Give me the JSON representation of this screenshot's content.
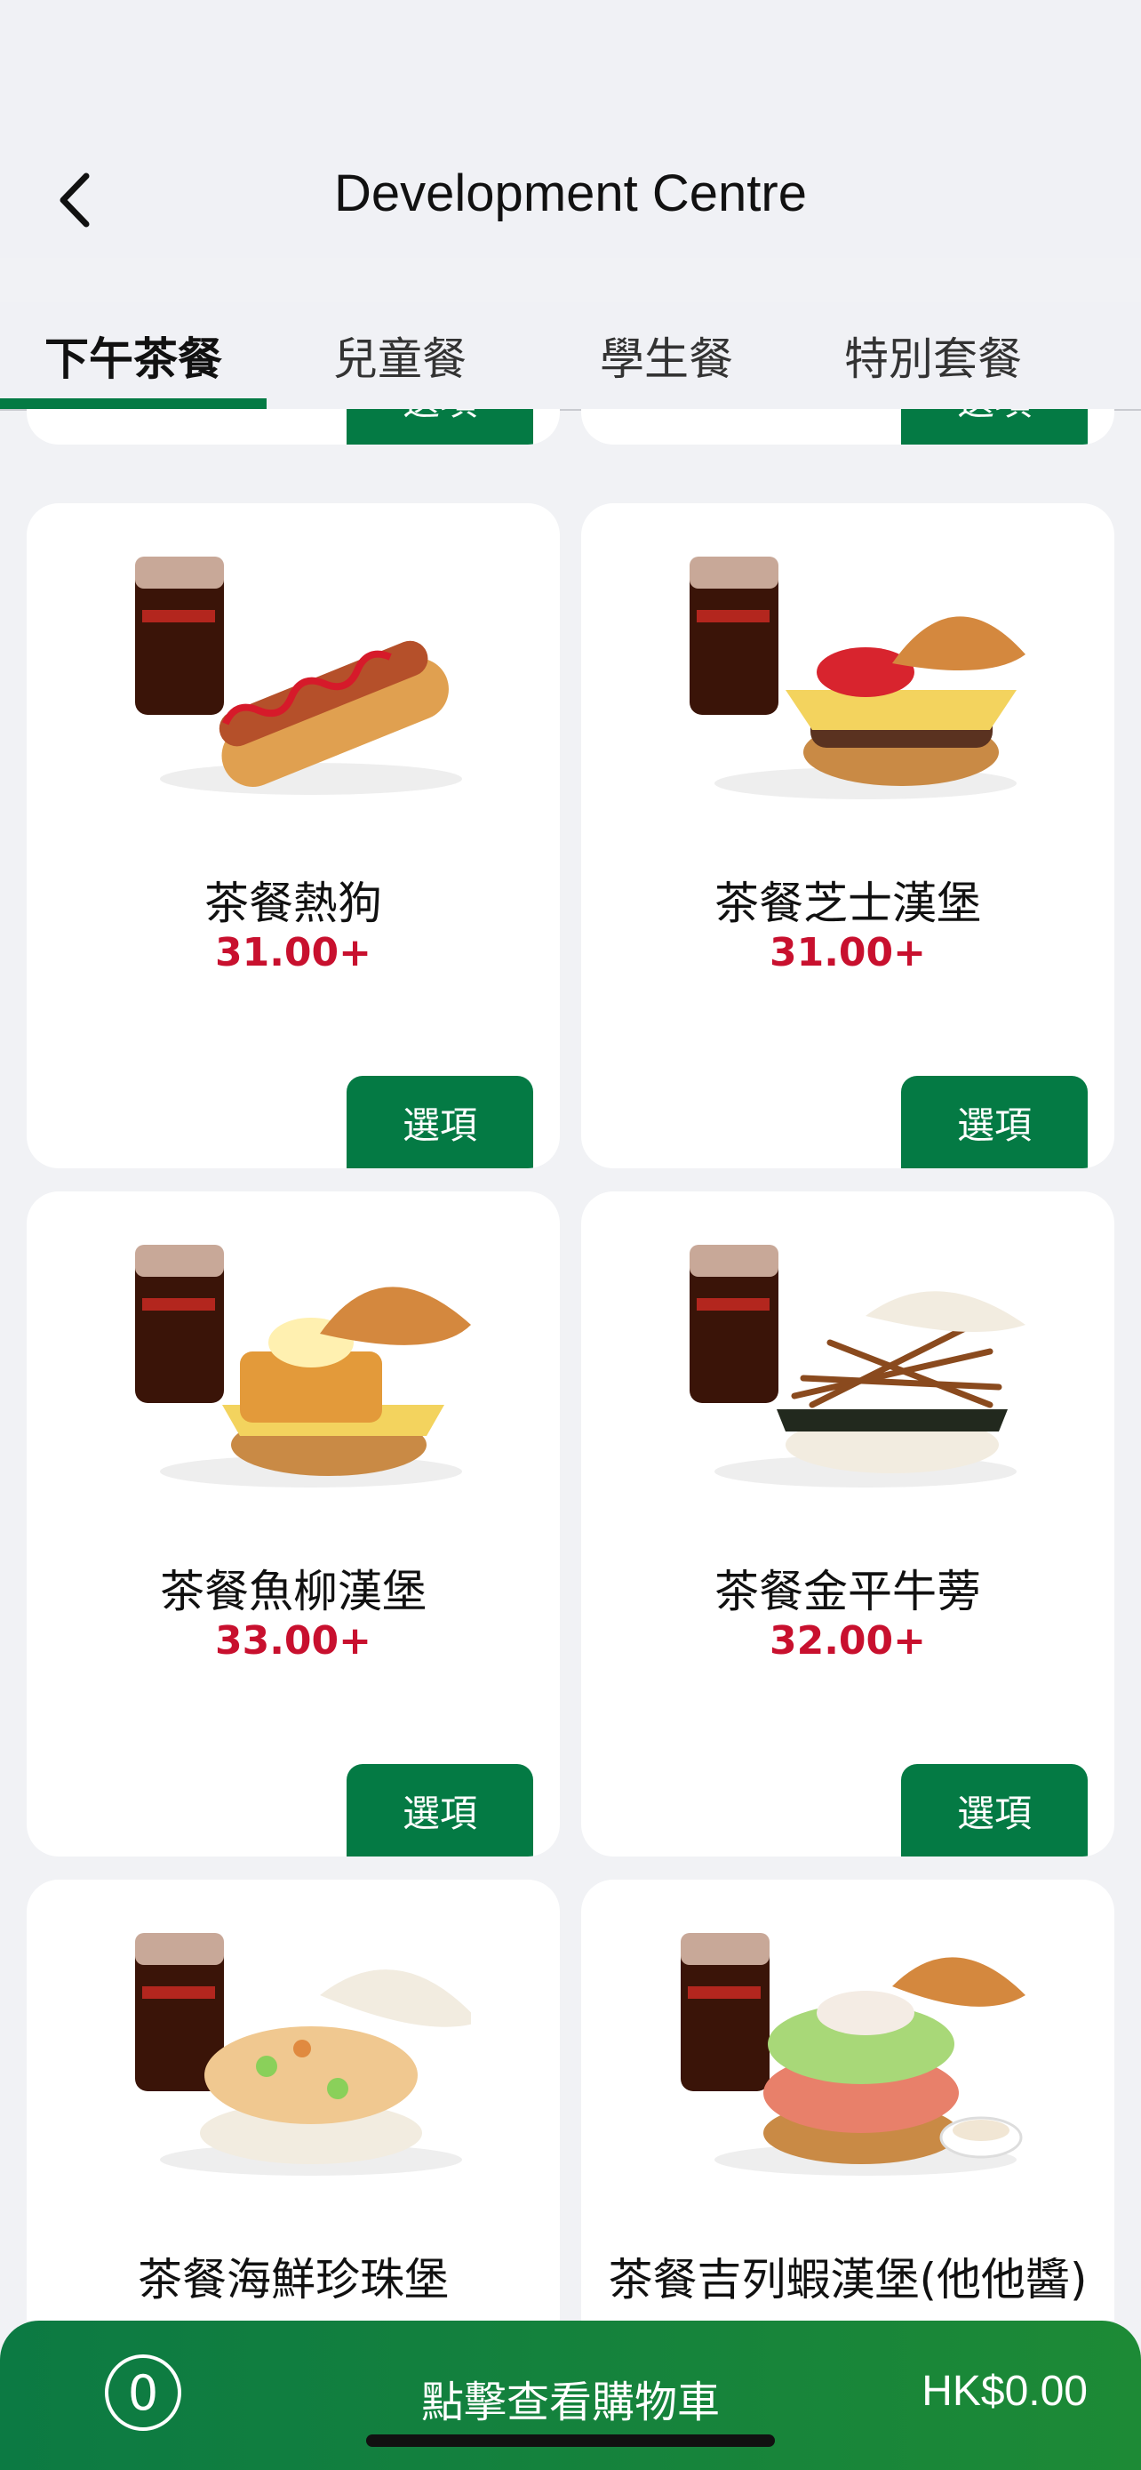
{
  "header": {
    "title": "Development Centre",
    "back_icon": "chevron-left-icon"
  },
  "tabs": [
    {
      "label": "下午茶餐",
      "active": true
    },
    {
      "label": "兒童餐",
      "active": false
    },
    {
      "label": "學生餐",
      "active": false
    },
    {
      "label": "特別套餐",
      "active": false
    }
  ],
  "option_label": "選項",
  "items": [
    {
      "name": "茶餐熱狗",
      "price": "31.00+",
      "image": "hotdog-with-cola"
    },
    {
      "name": "茶餐芝士漢堡",
      "price": "31.00+",
      "image": "cheeseburger-with-cola"
    },
    {
      "name": "茶餐魚柳漢堡",
      "price": "33.00+",
      "image": "fish-fillet-burger-with-cola"
    },
    {
      "name": "茶餐金平牛蒡",
      "price": "32.00+",
      "image": "kinpira-burdock-rice-burger-with-cola"
    },
    {
      "name": "茶餐海鮮珍珠堡",
      "price": "",
      "image": "seafood-rice-burger-with-cola"
    },
    {
      "name": "茶餐吉列蝦漢堡(他他醬)",
      "price": "",
      "image": "shrimp-cutlet-burger-with-cola"
    }
  ],
  "cart": {
    "count": "0",
    "label": "點擊查看購物車",
    "total": "HK$0.00"
  },
  "colors": {
    "accent": "#047a44",
    "price": "#c8102e",
    "bar": "#0c7a43"
  }
}
